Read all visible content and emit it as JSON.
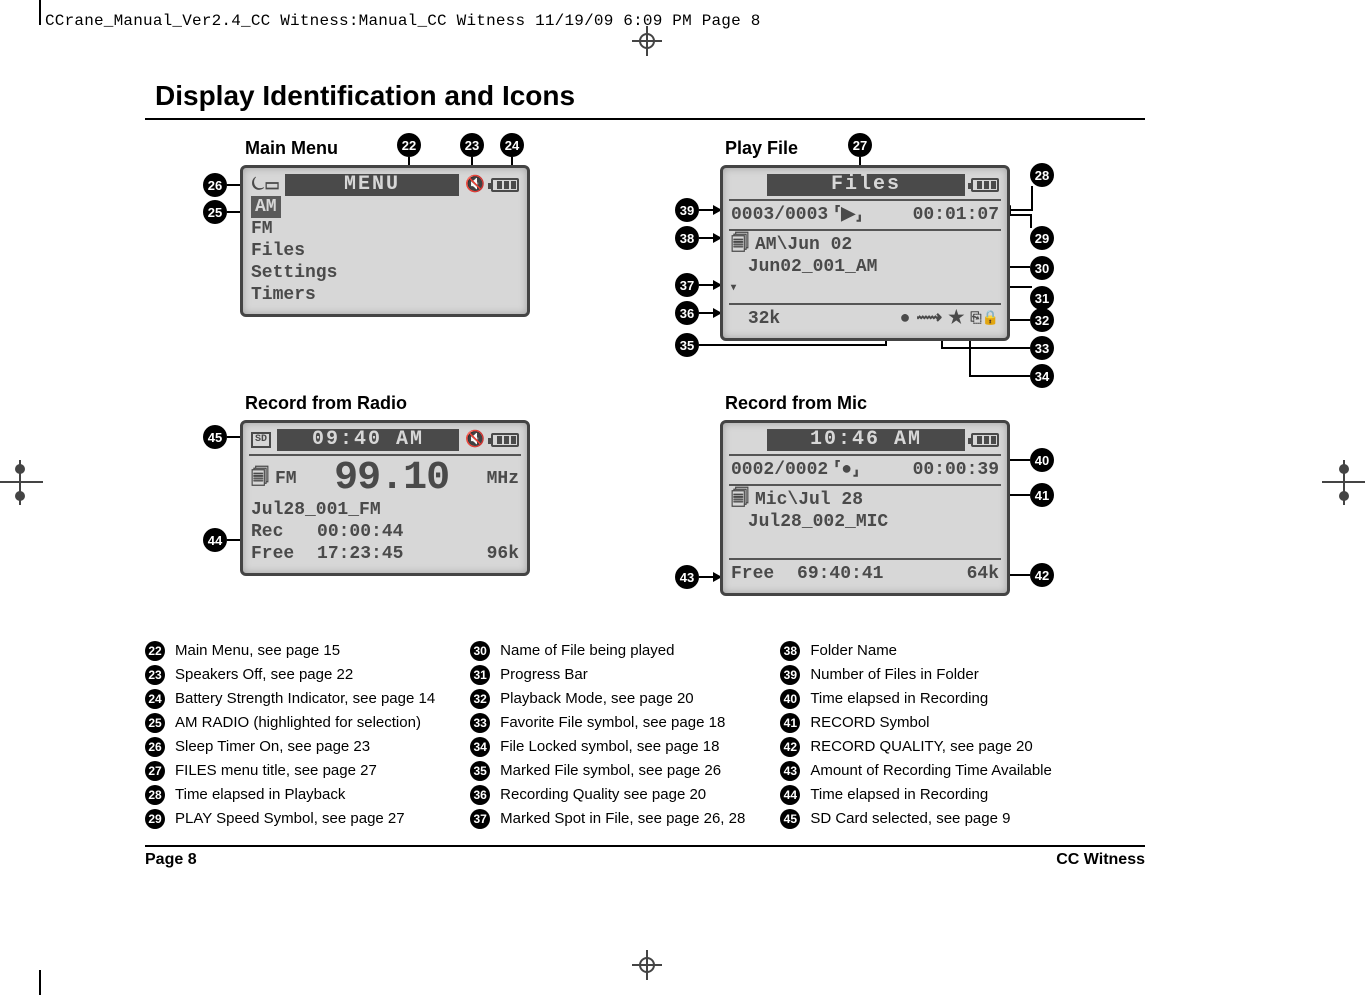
{
  "slug": "CCrane_Manual_Ver2.4_CC Witness:Manual_CC Witness  11/19/09  6:09 PM  Page 8",
  "title": "Display Identification and Icons",
  "footer": {
    "left": "Page 8",
    "right": "CC Witness"
  },
  "panels": {
    "mainmenu": {
      "label": "Main Menu",
      "menu_title": "MENU",
      "items": [
        "AM",
        "FM",
        "Files",
        "Settings",
        "Timers"
      ],
      "selected": "AM"
    },
    "playfile": {
      "label": "Play File",
      "files_title": "Files",
      "count": "0003/0003",
      "elapsed": "00:01:07",
      "folder": "AM\\Jun 02",
      "filename": "Jun02_001_AM",
      "quality": "32k"
    },
    "recradio": {
      "label": "Record from Radio",
      "clock": "09:40 AM",
      "band": "FM",
      "freq": "99.10",
      "unit": "MHz",
      "filename": "Jul28_001_FM",
      "rec_label": "Rec",
      "rec_time": "00:00:44",
      "free_label": "Free",
      "free_time": "17:23:45",
      "quality": "96k"
    },
    "recmic": {
      "label": "Record from Mic",
      "clock": "10:46 AM",
      "count": "0002/0002",
      "elapsed": "00:00:39",
      "folder": "Mic\\Jul 28",
      "filename": "Jul28_002_MIC",
      "free_label": "Free",
      "free_time": "69:40:41",
      "quality": "64k"
    }
  },
  "legend": {
    "col1": [
      {
        "n": "22",
        "t": "Main Menu, see page 15"
      },
      {
        "n": "23",
        "t": "Speakers Off, see page 22"
      },
      {
        "n": "24",
        "t": "Battery Strength Indicator, see page 14"
      },
      {
        "n": "25",
        "t": "AM RADIO (highlighted for selection)"
      },
      {
        "n": "26",
        "t": "Sleep Timer On, see page 23"
      },
      {
        "n": "27",
        "t": "FILES menu title, see page 27"
      },
      {
        "n": "28",
        "t": "Time elapsed in Playback"
      },
      {
        "n": "29",
        "t": "PLAY Speed Symbol, see page 27"
      }
    ],
    "col2": [
      {
        "n": "30",
        "t": "Name of File being played"
      },
      {
        "n": "31",
        "t": "Progress Bar"
      },
      {
        "n": "32",
        "t": "Playback Mode, see page 20"
      },
      {
        "n": "33",
        "t": "Favorite File symbol, see page 18"
      },
      {
        "n": "34",
        "t": "File Locked symbol, see page 18"
      },
      {
        "n": "35",
        "t": "Marked File symbol, see page 26"
      },
      {
        "n": "36",
        "t": "Recording Quality see page 20"
      },
      {
        "n": "37",
        "t": "Marked Spot in File, see page 26, 28"
      }
    ],
    "col3": [
      {
        "n": "38",
        "t": "Folder Name"
      },
      {
        "n": "39",
        "t": "Number of Files in Folder"
      },
      {
        "n": "40",
        "t": "Time elapsed in Recording"
      },
      {
        "n": "41",
        "t": "RECORD Symbol"
      },
      {
        "n": "42",
        "t": "RECORD QUALITY, see page 20"
      },
      {
        "n": "43",
        "t": "Amount of Recording Time Available"
      },
      {
        "n": "44",
        "t": "Time elapsed in Recording"
      },
      {
        "n": "45",
        "t": "SD Card selected, see page 9"
      }
    ]
  }
}
